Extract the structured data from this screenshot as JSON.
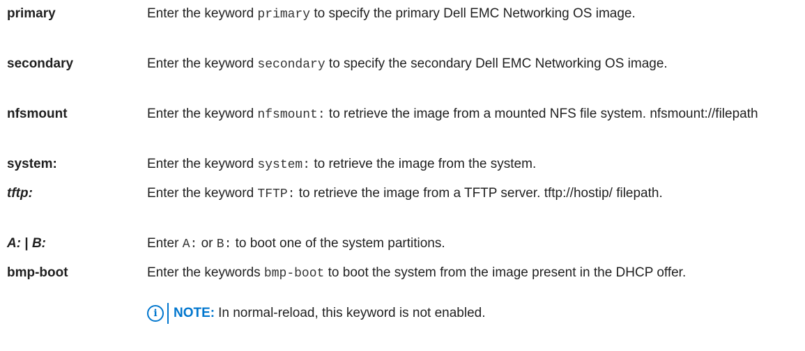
{
  "rows": [
    {
      "term": "primary",
      "desc_pre": "Enter the keyword ",
      "desc_code": "primary",
      "desc_post": " to specify the primary Dell EMC Networking OS image."
    },
    {
      "term": "secondary",
      "desc_pre": "Enter the keyword ",
      "desc_code": "secondary",
      "desc_post": " to specify the secondary Dell EMC Networking OS image."
    },
    {
      "term": "nfsmount",
      "desc_pre": "Enter the keyword ",
      "desc_code": "nfsmount:",
      "desc_post": " to retrieve the image from a mounted NFS file system. nfsmount://filepath"
    },
    {
      "term": "system:",
      "desc_pre": "Enter the keyword ",
      "desc_code": "system:",
      "desc_post": " to retrieve the image from the system."
    },
    {
      "term": "tftp:",
      "desc_pre": "Enter the keyword ",
      "desc_code": "TFTP:",
      "desc_post": " to retrieve the image from a TFTP server. tftp://hostip/ filepath."
    },
    {
      "term_a": "A:",
      "term_sep": " | ",
      "term_b": "B:",
      "desc_pre": "Enter ",
      "desc_code": "A:",
      "desc_mid": " or ",
      "desc_code2": "B:",
      "desc_post": " to boot one of the system partitions."
    },
    {
      "term": "bmp-boot",
      "desc_pre": "Enter the keywords ",
      "desc_code": "bmp-boot",
      "desc_post": " to boot the system from the image present in the DHCP offer.",
      "note_label": "NOTE:",
      "note_text": "In normal-reload, this keyword is not enabled."
    }
  ],
  "icons": {
    "note": "info-circle-icon"
  },
  "colors": {
    "text": "#1f1f1f",
    "accent": "#0076ce"
  }
}
